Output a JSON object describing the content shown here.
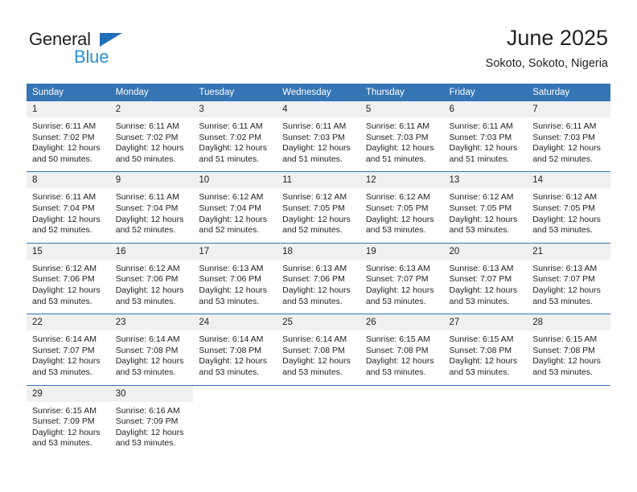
{
  "brand": {
    "name_part1": "General",
    "name_part2": "Blue",
    "triangle_color": "#1e6fb8",
    "blue_text_color": "#2a8fd4"
  },
  "header": {
    "title": "June 2025",
    "subtitle": "Sokoto, Sokoto, Nigeria"
  },
  "theme": {
    "header_row_color": "#3575b5",
    "daynum_background": "#f0f0f0",
    "text_color": "#222222"
  },
  "calendar": {
    "weekday_headers": [
      "Sunday",
      "Monday",
      "Tuesday",
      "Wednesday",
      "Thursday",
      "Friday",
      "Saturday"
    ],
    "weeks": [
      [
        {
          "day": "1",
          "sunrise": "Sunrise: 6:11 AM",
          "sunset": "Sunset: 7:02 PM",
          "daylight_line1": "Daylight: 12 hours",
          "daylight_line2": "and 50 minutes."
        },
        {
          "day": "2",
          "sunrise": "Sunrise: 6:11 AM",
          "sunset": "Sunset: 7:02 PM",
          "daylight_line1": "Daylight: 12 hours",
          "daylight_line2": "and 50 minutes."
        },
        {
          "day": "3",
          "sunrise": "Sunrise: 6:11 AM",
          "sunset": "Sunset: 7:02 PM",
          "daylight_line1": "Daylight: 12 hours",
          "daylight_line2": "and 51 minutes."
        },
        {
          "day": "4",
          "sunrise": "Sunrise: 6:11 AM",
          "sunset": "Sunset: 7:03 PM",
          "daylight_line1": "Daylight: 12 hours",
          "daylight_line2": "and 51 minutes."
        },
        {
          "day": "5",
          "sunrise": "Sunrise: 6:11 AM",
          "sunset": "Sunset: 7:03 PM",
          "daylight_line1": "Daylight: 12 hours",
          "daylight_line2": "and 51 minutes."
        },
        {
          "day": "6",
          "sunrise": "Sunrise: 6:11 AM",
          "sunset": "Sunset: 7:03 PM",
          "daylight_line1": "Daylight: 12 hours",
          "daylight_line2": "and 51 minutes."
        },
        {
          "day": "7",
          "sunrise": "Sunrise: 6:11 AM",
          "sunset": "Sunset: 7:03 PM",
          "daylight_line1": "Daylight: 12 hours",
          "daylight_line2": "and 52 minutes."
        }
      ],
      [
        {
          "day": "8",
          "sunrise": "Sunrise: 6:11 AM",
          "sunset": "Sunset: 7:04 PM",
          "daylight_line1": "Daylight: 12 hours",
          "daylight_line2": "and 52 minutes."
        },
        {
          "day": "9",
          "sunrise": "Sunrise: 6:11 AM",
          "sunset": "Sunset: 7:04 PM",
          "daylight_line1": "Daylight: 12 hours",
          "daylight_line2": "and 52 minutes."
        },
        {
          "day": "10",
          "sunrise": "Sunrise: 6:12 AM",
          "sunset": "Sunset: 7:04 PM",
          "daylight_line1": "Daylight: 12 hours",
          "daylight_line2": "and 52 minutes."
        },
        {
          "day": "11",
          "sunrise": "Sunrise: 6:12 AM",
          "sunset": "Sunset: 7:05 PM",
          "daylight_line1": "Daylight: 12 hours",
          "daylight_line2": "and 52 minutes."
        },
        {
          "day": "12",
          "sunrise": "Sunrise: 6:12 AM",
          "sunset": "Sunset: 7:05 PM",
          "daylight_line1": "Daylight: 12 hours",
          "daylight_line2": "and 53 minutes."
        },
        {
          "day": "13",
          "sunrise": "Sunrise: 6:12 AM",
          "sunset": "Sunset: 7:05 PM",
          "daylight_line1": "Daylight: 12 hours",
          "daylight_line2": "and 53 minutes."
        },
        {
          "day": "14",
          "sunrise": "Sunrise: 6:12 AM",
          "sunset": "Sunset: 7:05 PM",
          "daylight_line1": "Daylight: 12 hours",
          "daylight_line2": "and 53 minutes."
        }
      ],
      [
        {
          "day": "15",
          "sunrise": "Sunrise: 6:12 AM",
          "sunset": "Sunset: 7:06 PM",
          "daylight_line1": "Daylight: 12 hours",
          "daylight_line2": "and 53 minutes."
        },
        {
          "day": "16",
          "sunrise": "Sunrise: 6:12 AM",
          "sunset": "Sunset: 7:06 PM",
          "daylight_line1": "Daylight: 12 hours",
          "daylight_line2": "and 53 minutes."
        },
        {
          "day": "17",
          "sunrise": "Sunrise: 6:13 AM",
          "sunset": "Sunset: 7:06 PM",
          "daylight_line1": "Daylight: 12 hours",
          "daylight_line2": "and 53 minutes."
        },
        {
          "day": "18",
          "sunrise": "Sunrise: 6:13 AM",
          "sunset": "Sunset: 7:06 PM",
          "daylight_line1": "Daylight: 12 hours",
          "daylight_line2": "and 53 minutes."
        },
        {
          "day": "19",
          "sunrise": "Sunrise: 6:13 AM",
          "sunset": "Sunset: 7:07 PM",
          "daylight_line1": "Daylight: 12 hours",
          "daylight_line2": "and 53 minutes."
        },
        {
          "day": "20",
          "sunrise": "Sunrise: 6:13 AM",
          "sunset": "Sunset: 7:07 PM",
          "daylight_line1": "Daylight: 12 hours",
          "daylight_line2": "and 53 minutes."
        },
        {
          "day": "21",
          "sunrise": "Sunrise: 6:13 AM",
          "sunset": "Sunset: 7:07 PM",
          "daylight_line1": "Daylight: 12 hours",
          "daylight_line2": "and 53 minutes."
        }
      ],
      [
        {
          "day": "22",
          "sunrise": "Sunrise: 6:14 AM",
          "sunset": "Sunset: 7:07 PM",
          "daylight_line1": "Daylight: 12 hours",
          "daylight_line2": "and 53 minutes."
        },
        {
          "day": "23",
          "sunrise": "Sunrise: 6:14 AM",
          "sunset": "Sunset: 7:08 PM",
          "daylight_line1": "Daylight: 12 hours",
          "daylight_line2": "and 53 minutes."
        },
        {
          "day": "24",
          "sunrise": "Sunrise: 6:14 AM",
          "sunset": "Sunset: 7:08 PM",
          "daylight_line1": "Daylight: 12 hours",
          "daylight_line2": "and 53 minutes."
        },
        {
          "day": "25",
          "sunrise": "Sunrise: 6:14 AM",
          "sunset": "Sunset: 7:08 PM",
          "daylight_line1": "Daylight: 12 hours",
          "daylight_line2": "and 53 minutes."
        },
        {
          "day": "26",
          "sunrise": "Sunrise: 6:15 AM",
          "sunset": "Sunset: 7:08 PM",
          "daylight_line1": "Daylight: 12 hours",
          "daylight_line2": "and 53 minutes."
        },
        {
          "day": "27",
          "sunrise": "Sunrise: 6:15 AM",
          "sunset": "Sunset: 7:08 PM",
          "daylight_line1": "Daylight: 12 hours",
          "daylight_line2": "and 53 minutes."
        },
        {
          "day": "28",
          "sunrise": "Sunrise: 6:15 AM",
          "sunset": "Sunset: 7:08 PM",
          "daylight_line1": "Daylight: 12 hours",
          "daylight_line2": "and 53 minutes."
        }
      ],
      [
        {
          "day": "29",
          "sunrise": "Sunrise: 6:15 AM",
          "sunset": "Sunset: 7:09 PM",
          "daylight_line1": "Daylight: 12 hours",
          "daylight_line2": "and 53 minutes."
        },
        {
          "day": "30",
          "sunrise": "Sunrise: 6:16 AM",
          "sunset": "Sunset: 7:09 PM",
          "daylight_line1": "Daylight: 12 hours",
          "daylight_line2": "and 53 minutes."
        },
        null,
        null,
        null,
        null,
        null
      ]
    ]
  }
}
